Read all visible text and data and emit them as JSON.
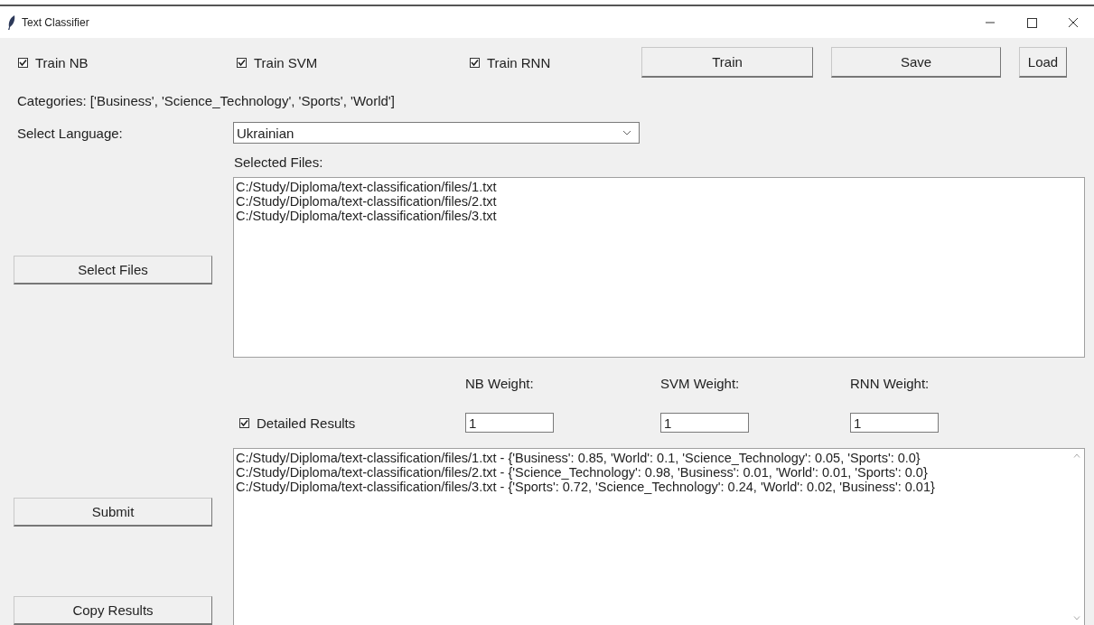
{
  "window": {
    "title": "Text Classifier"
  },
  "train_options": [
    {
      "label": "Train NB",
      "checked": true
    },
    {
      "label": "Train SVM",
      "checked": true
    },
    {
      "label": "Train RNN",
      "checked": true
    }
  ],
  "buttons": [
    {
      "label": "Train"
    },
    {
      "label": "Save"
    },
    {
      "label": "Load"
    }
  ],
  "categories": "Categories: ['Business', 'Science_Technology', 'Sports', 'World']",
  "language": {
    "label": "Select Language:",
    "value": "Ukrainian"
  },
  "selected_files": {
    "label": "Selected Files:",
    "files": [
      "C:/Study/Diploma/text-classification/files/1.txt",
      "C:/Study/Diploma/text-classification/files/2.txt",
      "C:/Study/Diploma/text-classification/files/3.txt"
    ]
  },
  "select_files_button": "Select Files",
  "weights": [
    {
      "label": "NB Weight:",
      "value": "1"
    },
    {
      "label": "SVM Weight:",
      "value": "1"
    },
    {
      "label": "RNN Weight:",
      "value": "1"
    }
  ],
  "detailed_results": {
    "label": "Detailed Results",
    "checked": true
  },
  "results": [
    "C:/Study/Diploma/text-classification/files/1.txt - {'Business': 0.85, 'World': 0.1, 'Science_Technology': 0.05, 'Sports': 0.0}",
    "C:/Study/Diploma/text-classification/files/2.txt - {'Science_Technology': 0.98, 'Business': 0.01, 'World': 0.01, 'Sports': 0.0}",
    "C:/Study/Diploma/text-classification/files/3.txt - {'Sports': 0.72, 'Science_Technology': 0.24, 'World': 0.02, 'Business': 0.01}"
  ],
  "submit_button": "Submit",
  "copy_button": "Copy Results"
}
